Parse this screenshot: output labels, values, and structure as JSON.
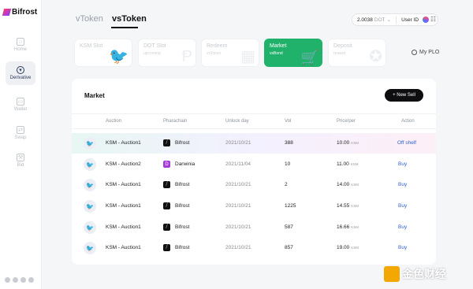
{
  "app": {
    "name": "Bifrost"
  },
  "sidebar": {
    "items": [
      {
        "label": "Home",
        "icon": "home-icon"
      },
      {
        "label": "Derivative",
        "icon": "derivative-icon",
        "active": true
      },
      {
        "label": "Wallet",
        "icon": "wallet-icon"
      },
      {
        "label": "Swap",
        "icon": "swap-icon"
      },
      {
        "label": "Bid",
        "icon": "bid-icon"
      }
    ]
  },
  "top_tabs": [
    {
      "label": "vToken"
    },
    {
      "label": "vsToken",
      "active": true
    }
  ],
  "header": {
    "balance_value": "2.0038",
    "balance_unit": "DOT",
    "user_label": "User ID"
  },
  "cards": [
    {
      "title": "KSM Slot",
      "subtitle": ""
    },
    {
      "title": "DOT Slot",
      "subtitle": "upcoming"
    },
    {
      "title": "Redeem",
      "subtitle": "vsToken"
    },
    {
      "title": "Market",
      "subtitle": "vsBond",
      "active": true
    },
    {
      "title": "Deposit",
      "subtitle": "reward"
    }
  ],
  "my_plo": "My PLO",
  "market": {
    "title": "Market",
    "new_sell": "+ New Sell",
    "columns": [
      "Auction",
      "Pharachain",
      "Unlock day",
      "Vol",
      "Price/per",
      "Action"
    ],
    "price_unit": "KSM",
    "rows": [
      {
        "auction": "KSM - Auction1",
        "chain": "Bifrost",
        "unlock": "2021/10/21",
        "vol": "388",
        "price": "10.00",
        "action": "Off shelf"
      },
      {
        "auction": "KSM - Auction2",
        "chain": "Darwinia",
        "unlock": "2021/11/04",
        "vol": "10",
        "price": "11.00",
        "action": "Buy"
      },
      {
        "auction": "KSM - Auction1",
        "chain": "Bifrost",
        "unlock": "2021/10/21",
        "vol": "2",
        "price": "14.00",
        "action": "Buy"
      },
      {
        "auction": "KSM - Auction1",
        "chain": "Bifrost",
        "unlock": "2021/10/21",
        "vol": "1225",
        "price": "14.55",
        "action": "Buy"
      },
      {
        "auction": "KSM - Auction1",
        "chain": "Bifrost",
        "unlock": "2021/10/21",
        "vol": "587",
        "price": "16.66",
        "action": "Buy"
      },
      {
        "auction": "KSM - Auction1",
        "chain": "Bifrost",
        "unlock": "2021/10/21",
        "vol": "857",
        "price": "19.00",
        "action": "Buy"
      }
    ]
  },
  "watermark": "金色财经",
  "colors": {
    "accent_green": "#20b26b",
    "link_blue": "#2f5fd0",
    "dark_button": "#0e0e10"
  }
}
